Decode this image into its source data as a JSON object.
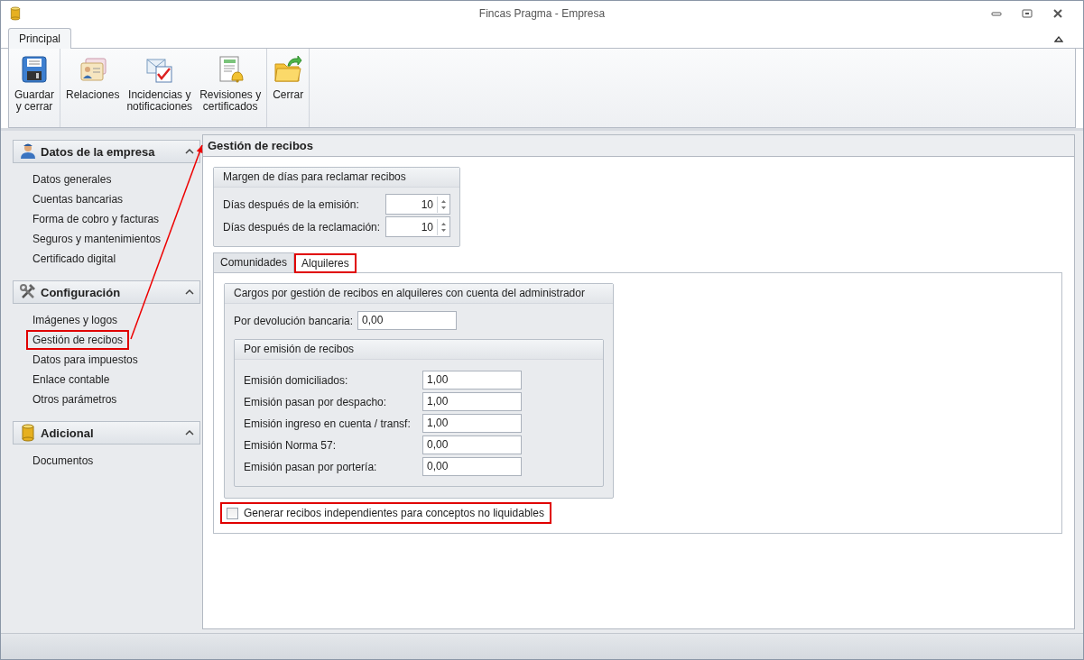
{
  "window": {
    "title": "Fincas Pragma - Empresa"
  },
  "ribbon": {
    "tabs": [
      {
        "label": "Principal",
        "selected": true
      }
    ],
    "groups": [
      {
        "buttons": [
          {
            "kind": "floppy",
            "label_lines": [
              "Guardar",
              "y cerrar"
            ]
          }
        ]
      },
      {
        "buttons": [
          {
            "kind": "contacts",
            "label_lines": [
              "Relaciones"
            ]
          },
          {
            "kind": "mail-check",
            "label_lines": [
              "Incidencias y",
              "notificaciones"
            ]
          },
          {
            "kind": "notebook-bell",
            "label_lines": [
              "Revisiones y",
              "certificados"
            ]
          }
        ]
      },
      {
        "buttons": [
          {
            "kind": "folder",
            "label_lines": [
              "Cerrar"
            ]
          }
        ]
      }
    ]
  },
  "sidebar": {
    "sections": [
      {
        "title": "Datos de la empresa",
        "kind": "person",
        "expanded": true,
        "items": [
          {
            "label": "Datos generales",
            "highlighted": false
          },
          {
            "label": "Cuentas bancarias",
            "highlighted": false
          },
          {
            "label": "Forma de cobro y facturas",
            "highlighted": false
          },
          {
            "label": "Seguros y mantenimientos",
            "highlighted": false
          },
          {
            "label": "Certificado digital",
            "highlighted": false
          }
        ]
      },
      {
        "title": "Configuración",
        "kind": "tools",
        "expanded": true,
        "items": [
          {
            "label": "Imágenes y logos",
            "highlighted": false
          },
          {
            "label": "Gestión de recibos",
            "highlighted": true
          },
          {
            "label": "Datos para impuestos",
            "highlighted": false
          },
          {
            "label": "Enlace contable",
            "highlighted": false
          },
          {
            "label": "Otros parámetros",
            "highlighted": false
          }
        ]
      },
      {
        "title": "Adicional",
        "kind": "cylinder",
        "expanded": true,
        "items": [
          {
            "label": "Documentos",
            "highlighted": false
          }
        ]
      }
    ]
  },
  "content": {
    "title": "Gestión de recibos",
    "margin_group": {
      "title": "Margen de días para reclamar recibos",
      "fields": [
        {
          "label": "Días después de la emisión:",
          "value": "10"
        },
        {
          "label": "Días después de la reclamación:",
          "value": "10"
        }
      ]
    },
    "tabs": [
      {
        "label": "Comunidades",
        "selected": false,
        "highlighted": false
      },
      {
        "label": "Alquileres",
        "selected": true,
        "highlighted": true
      }
    ],
    "charges_group": {
      "title": "Cargos por gestión de recibos en alquileres con cuenta del administrador",
      "fields": [
        {
          "label": "Por devolución bancaria:",
          "value": "0,00"
        }
      ],
      "subgroup": {
        "title": "Por emisión de recibos",
        "fields": [
          {
            "label": "Emisión domiciliados:",
            "value": "1,00"
          },
          {
            "label": "Emisión pasan por despacho:",
            "value": "1,00"
          },
          {
            "label": "Emisión ingreso en cuenta / transf:",
            "value": "1,00"
          },
          {
            "label": "Emisión Norma 57:",
            "value": "0,00"
          },
          {
            "label": "Emisión pasan por portería:",
            "value": "0,00"
          }
        ]
      }
    },
    "checkbox": {
      "label": "Generar recibos independientes para conceptos no liquidables",
      "checked": false,
      "highlighted": true
    }
  }
}
